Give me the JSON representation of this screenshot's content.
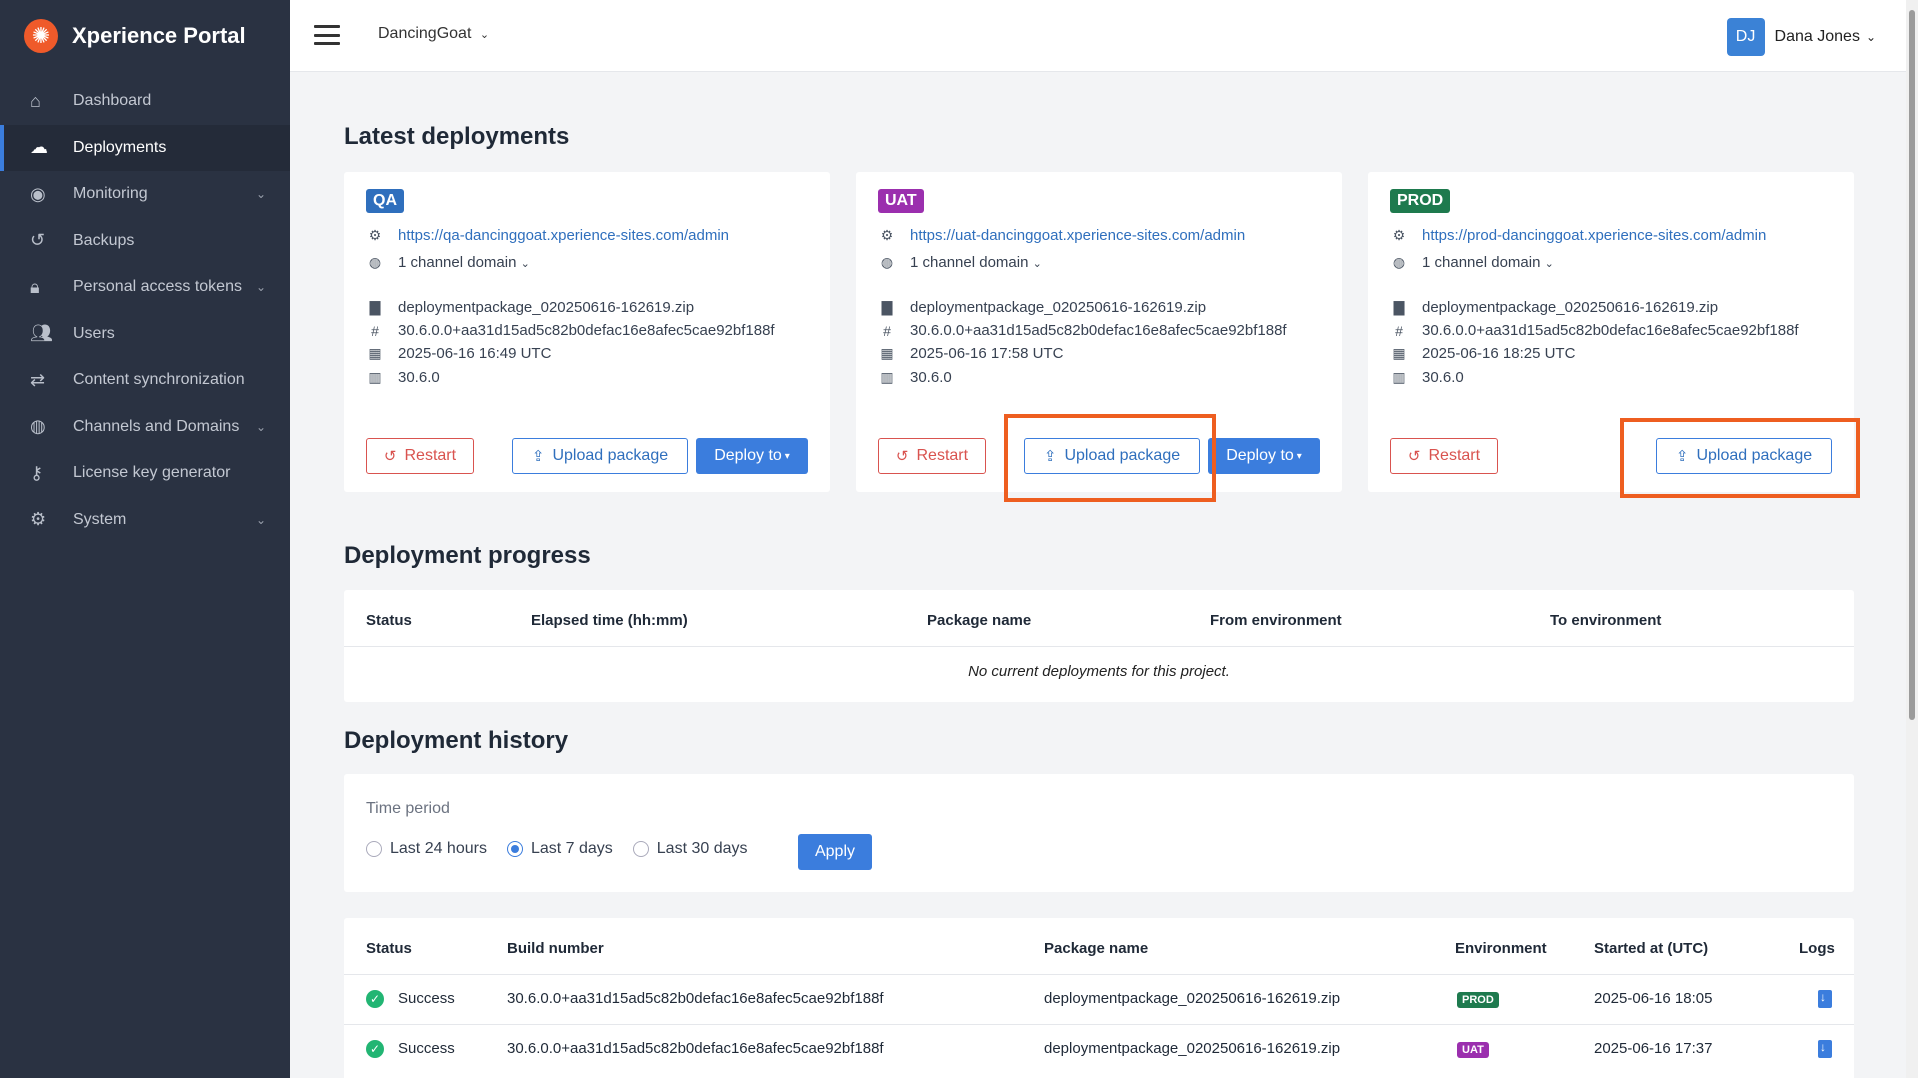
{
  "app": {
    "name": "Xperience Portal",
    "project": "DancingGoat"
  },
  "user": {
    "initials": "DJ",
    "name": "Dana Jones"
  },
  "nav": [
    {
      "label": "Dashboard",
      "icon": "home-icon",
      "has_children": false,
      "active": false
    },
    {
      "label": "Deployments",
      "icon": "cloud-upload-icon",
      "has_children": false,
      "active": true
    },
    {
      "label": "Monitoring",
      "icon": "eye-icon",
      "has_children": true,
      "active": false
    },
    {
      "label": "Backups",
      "icon": "history-icon",
      "has_children": false,
      "active": false
    },
    {
      "label": "Personal access tokens",
      "icon": "lock-icon",
      "has_children": true,
      "active": false
    },
    {
      "label": "Users",
      "icon": "users-icon",
      "has_children": false,
      "active": false
    },
    {
      "label": "Content synchronization",
      "icon": "sync-icon",
      "has_children": false,
      "active": false
    },
    {
      "label": "Channels and Domains",
      "icon": "globe-icon",
      "has_children": true,
      "active": false
    },
    {
      "label": "License key generator",
      "icon": "key-icon",
      "has_children": false,
      "active": false
    },
    {
      "label": "System",
      "icon": "gears-icon",
      "has_children": true,
      "active": false
    }
  ],
  "latest": {
    "title": "Latest deployments",
    "envs": [
      {
        "badge": "QA",
        "color": "#2f6fbd",
        "url": "https://qa-dancinggoat.xperience-sites.com/admin",
        "domains": "1 channel domain",
        "package": "deploymentpackage_020250616-162619.zip",
        "build": "30.6.0.0+aa31d15ad5c82b0defac16e8afec5cae92bf188f",
        "date": "2025-06-16 16:49 UTC",
        "version": "30.6.0",
        "restart": "Restart",
        "upload": "Upload package",
        "deploy": "Deploy to"
      },
      {
        "badge": "UAT",
        "color": "#9b2fae",
        "url": "https://uat-dancinggoat.xperience-sites.com/admin",
        "domains": "1 channel domain",
        "package": "deploymentpackage_020250616-162619.zip",
        "build": "30.6.0.0+aa31d15ad5c82b0defac16e8afec5cae92bf188f",
        "date": "2025-06-16 17:58 UTC",
        "version": "30.6.0",
        "restart": "Restart",
        "upload": "Upload package",
        "deploy": "Deploy to"
      },
      {
        "badge": "PROD",
        "color": "#1e7a4e",
        "url": "https://prod-dancinggoat.xperience-sites.com/admin",
        "domains": "1 channel domain",
        "package": "deploymentpackage_020250616-162619.zip",
        "build": "30.6.0.0+aa31d15ad5c82b0defac16e8afec5cae92bf188f",
        "date": "2025-06-16 18:25 UTC",
        "version": "30.6.0",
        "restart": "Restart",
        "upload": "Upload package"
      }
    ]
  },
  "progress": {
    "title": "Deployment progress",
    "columns": [
      "Status",
      "Elapsed time (hh:mm)",
      "Package name",
      "From environment",
      "To environment"
    ],
    "empty": "No current deployments for this project."
  },
  "history": {
    "title": "Deployment history",
    "period_label": "Time period",
    "options": [
      "Last 24 hours",
      "Last 7 days",
      "Last 30 days"
    ],
    "selected": "Last 7 days",
    "apply": "Apply",
    "columns": [
      "Status",
      "Build number",
      "Package name",
      "Environment",
      "Started at (UTC)",
      "Logs"
    ],
    "rows": [
      {
        "status": "Success",
        "build": "30.6.0.0+aa31d15ad5c82b0defac16e8afec5cae92bf188f",
        "package": "deploymentpackage_020250616-162619.zip",
        "env": "PROD",
        "env_color": "#1e7a4e",
        "started": "2025-06-16 18:05"
      },
      {
        "status": "Success",
        "build": "30.6.0.0+aa31d15ad5c82b0defac16e8afec5cae92bf188f",
        "package": "deploymentpackage_020250616-162619.zip",
        "env": "UAT",
        "env_color": "#9b2fae",
        "started": "2025-06-16 17:37"
      }
    ]
  }
}
